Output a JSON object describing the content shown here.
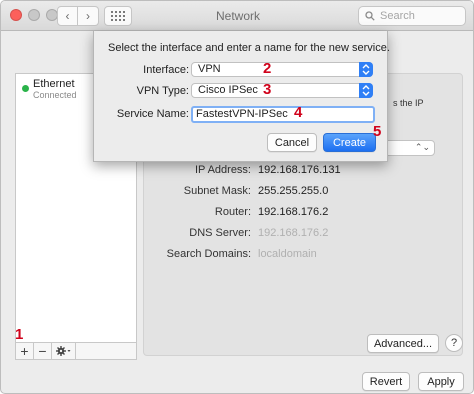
{
  "window": {
    "title": "Network",
    "search_placeholder": "Search",
    "colors": {
      "close": "#fc605b",
      "accent": "#2f7ff6"
    }
  },
  "sidebar": {
    "items": [
      {
        "name": "Ethernet",
        "status": "Connected",
        "status_color": "#2ab34a"
      }
    ],
    "controls": {
      "add": "+",
      "remove": "−",
      "action_icon": "gear-icon"
    }
  },
  "annotations": {
    "n1": "1",
    "n2": "2",
    "n3": "3",
    "n4": "4",
    "n5": "5"
  },
  "panel": {
    "hint_text": "s the IP",
    "rows": [
      {
        "label": "IP Address:",
        "value": "192.168.176.131"
      },
      {
        "label": "Subnet Mask:",
        "value": "255.255.255.0"
      },
      {
        "label": "Router:",
        "value": "192.168.176.2"
      },
      {
        "label": "DNS Server:",
        "value": "192.168.176.2"
      },
      {
        "label": "Search Domains:",
        "value": "localdomain"
      }
    ],
    "advanced_label": "Advanced...",
    "help_label": "?"
  },
  "footer": {
    "revert_label": "Revert",
    "apply_label": "Apply"
  },
  "dialog": {
    "message": "Select the interface and enter a name for the new service.",
    "interface_label": "Interface:",
    "interface_value": "VPN",
    "vpn_type_label": "VPN Type:",
    "vpn_type_value": "Cisco IPSec",
    "service_name_label": "Service Name:",
    "service_name_value": "FastestVPN-IPSec",
    "cancel_label": "Cancel",
    "create_label": "Create"
  }
}
